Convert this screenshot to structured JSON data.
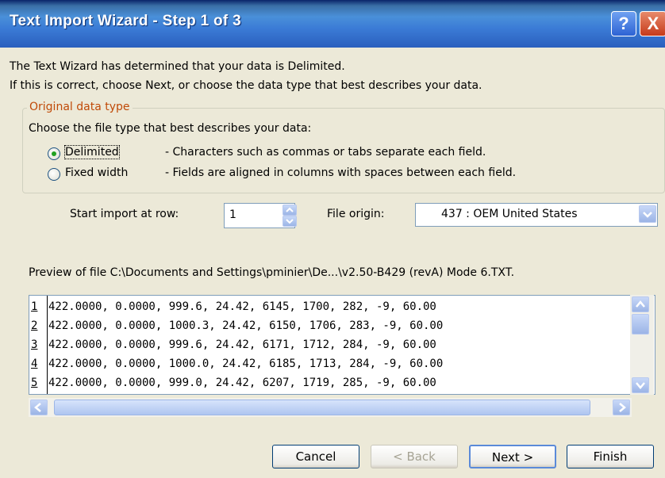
{
  "window": {
    "title": "Text Import Wizard - Step 1 of 3",
    "help_label": "?",
    "close_label": "X"
  },
  "intro": {
    "line1": "The Text Wizard has determined that your data is Delimited.",
    "line2": "If this is correct, choose Next, or choose the data type that best describes your data."
  },
  "original_type": {
    "legend": "Original data type",
    "prompt": "Choose the file type that best describes your data:",
    "options": [
      {
        "label": "Delimited",
        "selected": true,
        "description": "- Characters such as commas or tabs separate each field."
      },
      {
        "label": "Fixed width",
        "selected": false,
        "description": "- Fields are aligned in columns with spaces between each field."
      }
    ]
  },
  "import_row": {
    "label": "Start import at row:",
    "value": "1"
  },
  "file_origin": {
    "label": "File origin:",
    "value": "437 : OEM United States"
  },
  "preview": {
    "caption": "Preview of file C:\\Documents and Settings\\pminier\\De...\\v2.50-B429 (revA) Mode 6.TXT.",
    "rows": [
      {
        "num": "1",
        "text": "422.0000, 0.0000, 999.6, 24.42, 6145, 1700, 282, -9, 60.00"
      },
      {
        "num": "2",
        "text": "422.0000, 0.0000, 1000.3, 24.42, 6150, 1706, 283, -9, 60.00"
      },
      {
        "num": "3",
        "text": "422.0000, 0.0000, 999.6, 24.42, 6171, 1712, 284, -9, 60.00"
      },
      {
        "num": "4",
        "text": "422.0000, 0.0000, 1000.0, 24.42, 6185, 1713, 284, -9, 60.00"
      },
      {
        "num": "5",
        "text": "422.0000, 0.0000, 999.0, 24.42, 6207, 1719, 285, -9, 60.00"
      }
    ]
  },
  "buttons": {
    "cancel": "Cancel",
    "back": "< Back",
    "next": "Next >",
    "finish": "Finish"
  },
  "colors": {
    "title_bar": "#2a5fbe",
    "legend_text": "#c04a08",
    "dialog_bg": "#ece9d8",
    "close_button": "#c63a1a"
  },
  "icons": [
    "help-icon",
    "close-icon",
    "spin-up-icon",
    "spin-down-icon",
    "dropdown-arrow-icon",
    "scroll-up-icon",
    "scroll-down-icon",
    "scroll-left-icon",
    "scroll-right-icon"
  ]
}
